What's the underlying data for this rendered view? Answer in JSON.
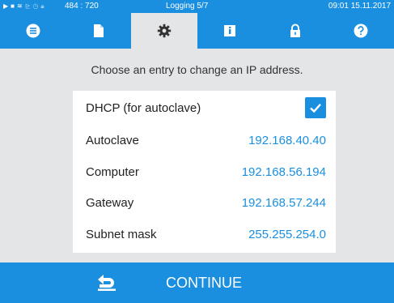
{
  "status": {
    "coords": "484 : 720",
    "logging": "Logging 5/7",
    "datetime": "09:01  15.11.2017"
  },
  "tabs": [
    {
      "icon": "list-icon",
      "active": false
    },
    {
      "icon": "document-icon",
      "active": false
    },
    {
      "icon": "gear-icon",
      "active": true
    },
    {
      "icon": "info-book-icon",
      "active": false
    },
    {
      "icon": "lock-icon",
      "active": false
    },
    {
      "icon": "help-icon",
      "active": false
    }
  ],
  "prompt": "Choose an entry to change an IP address.",
  "settings": {
    "dhcp": {
      "label": "DHCP (for autoclave)",
      "checked": true
    },
    "rows": [
      {
        "label": "Autoclave",
        "value": "192.168.40.40"
      },
      {
        "label": "Computer",
        "value": "192.168.56.194"
      },
      {
        "label": "Gateway",
        "value": "192.168.57.244"
      },
      {
        "label": "Subnet mask",
        "value": "255.255.254.0"
      }
    ]
  },
  "footer": {
    "back_icon": "back-arrow-icon",
    "continue_label": "CONTINUE"
  },
  "colors": {
    "accent": "#1a8fe0",
    "background": "#e3e5e6",
    "panel": "#ffffff"
  }
}
